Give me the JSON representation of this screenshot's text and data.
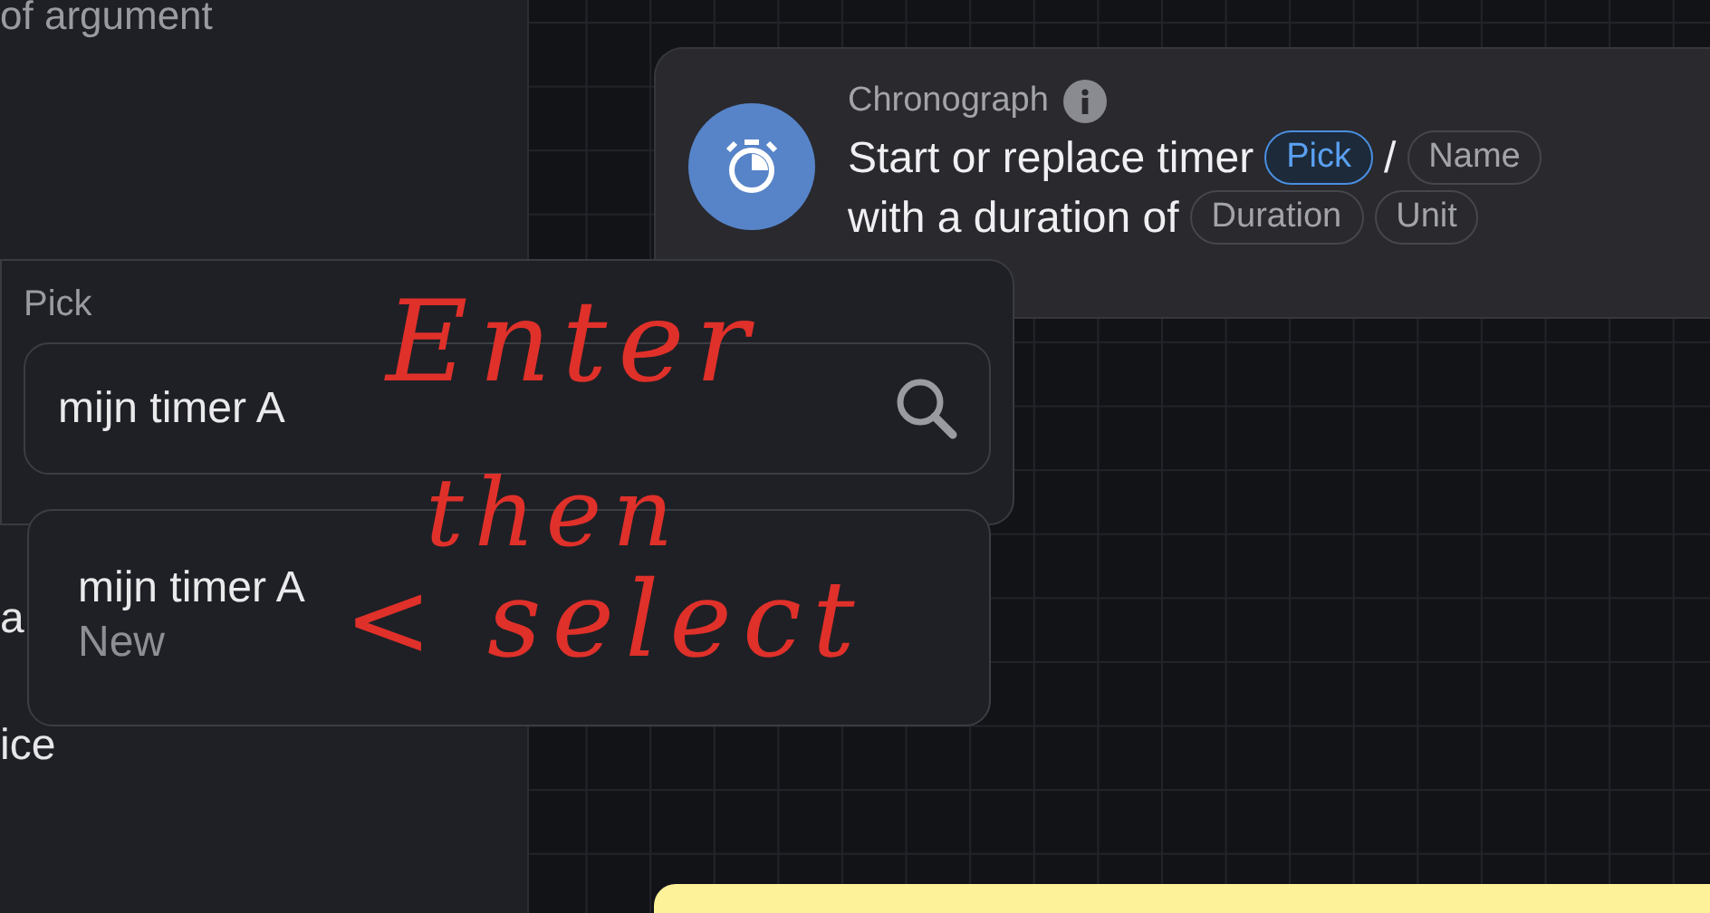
{
  "sidebar": {
    "texts": [
      "of argument",
      "a",
      "ice"
    ]
  },
  "node": {
    "category": "Chronograph",
    "lines": [
      [
        {
          "kind": "text",
          "text": "Start or replace timer"
        },
        {
          "kind": "chip",
          "text": "Pick",
          "selected": true
        },
        {
          "kind": "text",
          "text": "/"
        },
        {
          "kind": "chip",
          "text": "Name",
          "selected": false
        }
      ],
      [
        {
          "kind": "text",
          "text": "with a duration of"
        },
        {
          "kind": "chip",
          "text": "Duration",
          "selected": false
        },
        {
          "kind": "chip",
          "text": "Unit",
          "selected": false
        }
      ]
    ]
  },
  "picker": {
    "label": "Pick",
    "search": {
      "value": "mijn timer A"
    },
    "options": [
      {
        "title": "mijn timer A",
        "subtitle": "New"
      }
    ]
  },
  "annotation": [
    "Enter",
    "then",
    "< select"
  ]
}
